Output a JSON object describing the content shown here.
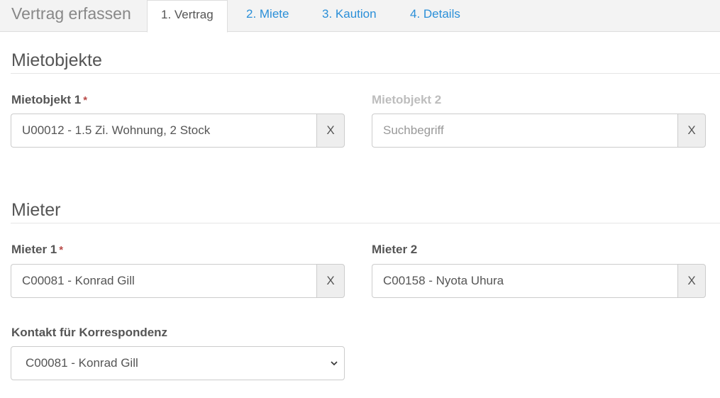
{
  "header": {
    "title": "Vertrag erfassen",
    "tabs": [
      {
        "label": "1. Vertrag",
        "active": true
      },
      {
        "label": "2. Miete",
        "active": false
      },
      {
        "label": "3. Kaution",
        "active": false
      },
      {
        "label": "4. Details",
        "active": false
      }
    ]
  },
  "mietobjekte": {
    "title": "Mietobjekte",
    "objekt1": {
      "label": "Mietobjekt 1",
      "required": "*",
      "value": "U00012 - 1.5 Zi. Wohnung, 2 Stock",
      "clear": "X"
    },
    "objekt2": {
      "label": "Mietobjekt 2",
      "placeholder": "Suchbegriff",
      "clear": "X"
    }
  },
  "mieter": {
    "title": "Mieter",
    "mieter1": {
      "label": "Mieter 1",
      "required": "*",
      "value": "C00081 - Konrad Gill",
      "clear": "X"
    },
    "mieter2": {
      "label": "Mieter 2",
      "value": "C00158 - Nyota Uhura",
      "clear": "X"
    },
    "kontakt": {
      "label": "Kontakt für Korrespondenz",
      "selected": "C00081 - Konrad Gill"
    }
  },
  "colors": {
    "link": "#2a8fd8",
    "required": "#b94a48",
    "text": "#555555"
  }
}
